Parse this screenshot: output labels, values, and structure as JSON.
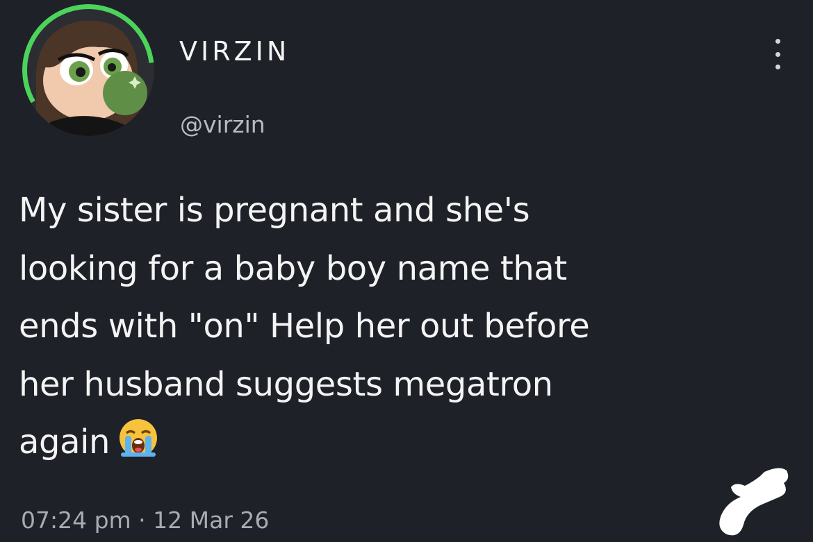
{
  "tweet": {
    "display_name": "VIRZIN",
    "handle": "@virzin",
    "text_lines": [
      "My sister is pregnant and she's",
      "looking for a baby boy name that",
      "ends with \"on\" Help her out before",
      "her husband suggests megatron",
      "again"
    ],
    "emoji": "loudly-crying-face-emoji",
    "timestamp": "07:24 pm · 12 Mar 26"
  },
  "icons": {
    "more": "vertical-ellipsis-icon",
    "avatar": "cartoon-avatar"
  },
  "colors": {
    "background": "#1f2128",
    "avatar_ring": "#4cd35a",
    "text": "#f4f4f4",
    "muted_text": "#a9abb3"
  }
}
